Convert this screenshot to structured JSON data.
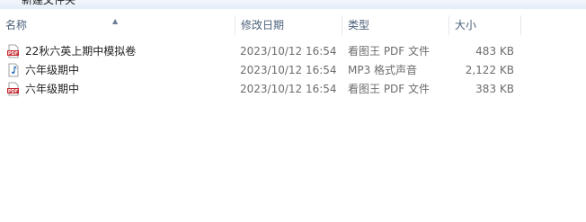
{
  "toolbar": {
    "new_folder_label": "新建文件夹"
  },
  "columns": {
    "name": "名称",
    "date": "修改日期",
    "type": "类型",
    "size": "大小"
  },
  "files": [
    {
      "name": "22秋六英上期中模拟卷",
      "date": "2023/10/12 16:54",
      "type": "看图王 PDF 文件",
      "size": "483 KB",
      "icon": "pdf-file-icon"
    },
    {
      "name": "六年级期中",
      "date": "2023/10/12 16:54",
      "type": "MP3 格式声音",
      "size": "2,122 KB",
      "icon": "audio-file-icon"
    },
    {
      "name": "六年级期中",
      "date": "2023/10/12 16:54",
      "type": "看图王 PDF 文件",
      "size": "383 KB",
      "icon": "pdf-file-icon"
    }
  ]
}
